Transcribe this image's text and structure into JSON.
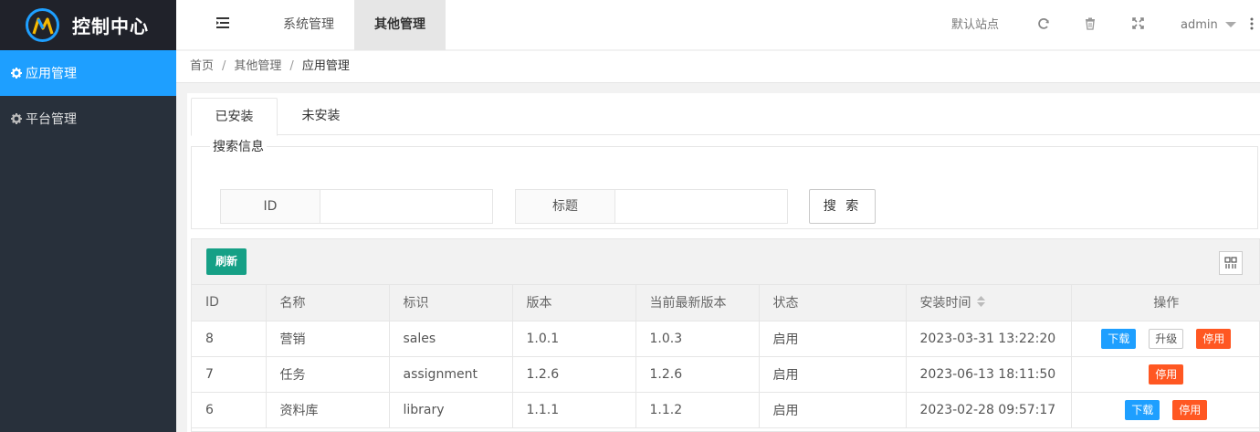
{
  "app": {
    "title": "控制中心",
    "accent": "#1e9fff"
  },
  "sidebar": {
    "items": [
      {
        "label": "应用管理",
        "active": true,
        "icon": "gear-icon"
      },
      {
        "label": "平台管理",
        "active": false,
        "icon": "gear-icon"
      }
    ]
  },
  "header": {
    "tabs": [
      {
        "label": "系统管理"
      },
      {
        "label": "其他管理"
      }
    ],
    "default_site": "默认站点",
    "user": "admin"
  },
  "breadcrumb": [
    "首页",
    "其他管理",
    "应用管理"
  ],
  "content": {
    "tabs": [
      {
        "label": "已安装"
      },
      {
        "label": "未安装"
      }
    ],
    "search": {
      "legend": "搜索信息",
      "id_label": "ID",
      "title_label": "标题",
      "id_value": "",
      "title_value": "",
      "button": "搜 索"
    },
    "toolbar": {
      "refresh": "刷新"
    },
    "table": {
      "columns": [
        "ID",
        "名称",
        "标识",
        "版本",
        "当前最新版本",
        "状态",
        "安装时间",
        "操作"
      ],
      "rows": [
        {
          "id": "8",
          "name": "营销",
          "key": "sales",
          "version": "1.0.1",
          "latest": "1.0.3",
          "status": "启用",
          "time": "2023-03-31 13:22:20"
        },
        {
          "id": "7",
          "name": "任务",
          "key": "assignment",
          "version": "1.2.6",
          "latest": "1.2.6",
          "status": "启用",
          "time": "2023-06-13 18:11:50"
        },
        {
          "id": "6",
          "name": "资料库",
          "key": "library",
          "version": "1.1.1",
          "latest": "1.1.2",
          "status": "启用",
          "time": "2023-02-28 09:57:17"
        }
      ],
      "actions": {
        "download": "下载",
        "upgrade": "升级",
        "disable": "停用"
      }
    }
  }
}
